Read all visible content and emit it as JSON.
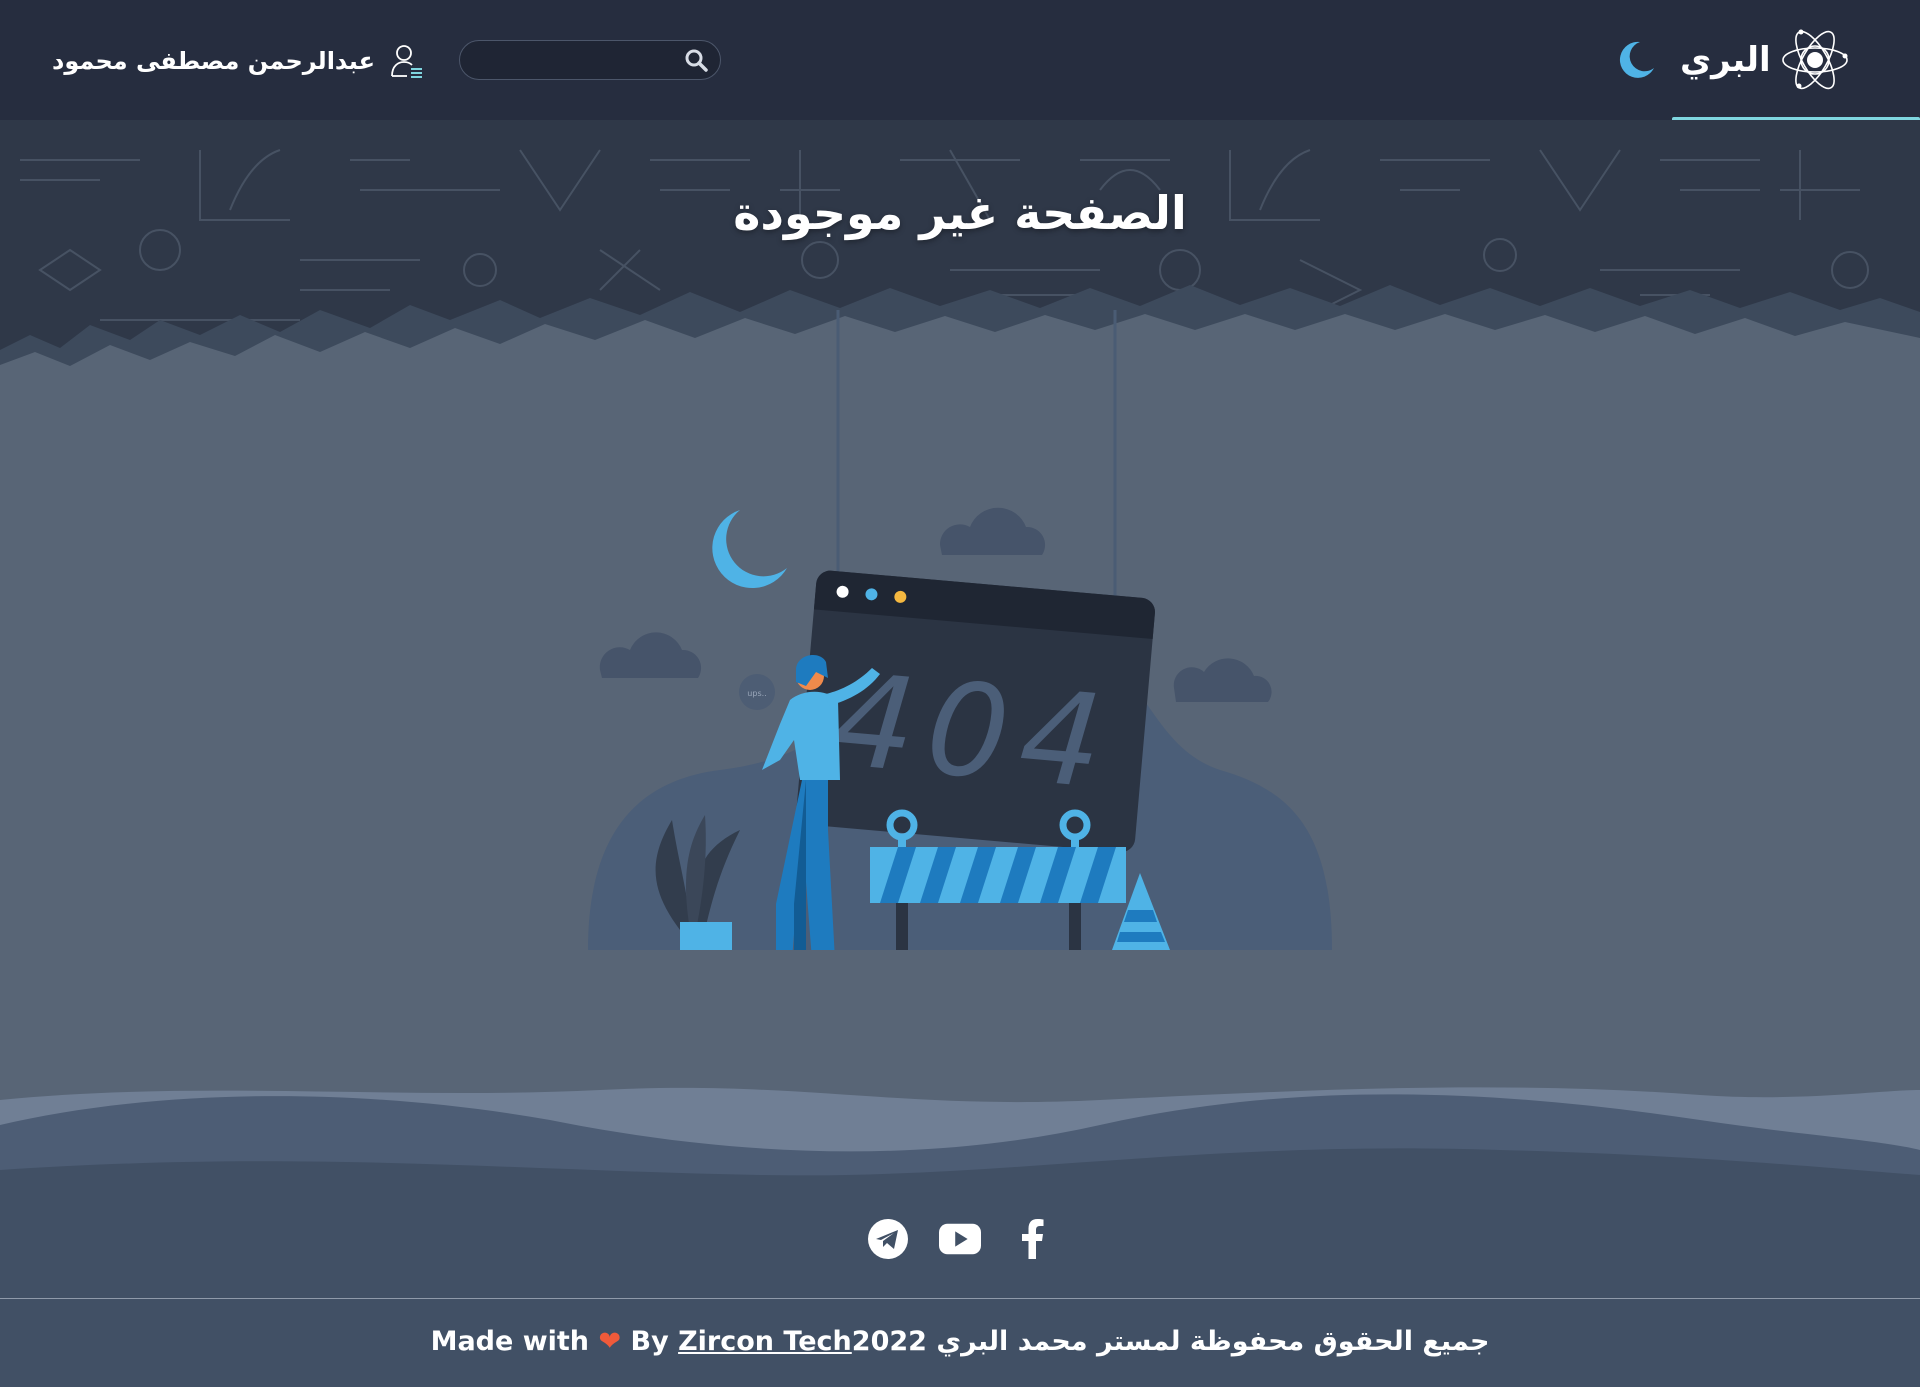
{
  "header": {
    "brand_name": "البري",
    "user_name": "عبدالرحمن مصطفى محمود",
    "search": {
      "value": "",
      "placeholder": ""
    }
  },
  "main": {
    "title": "الصفحة غير موجودة",
    "illustration": {
      "code_text": "404",
      "bubble_text": "ups.."
    }
  },
  "footer": {
    "socials": [
      "telegram-icon",
      "youtube-icon",
      "facebook-icon"
    ],
    "copyright_ar": "جميع الحقوق محفوظة لمستر محمد البري 2022",
    "made_with": "Made with",
    "by": "By",
    "company": "Zircon Tech"
  },
  "colors": {
    "header_bg": "#262d3f",
    "page_bg": "#586576",
    "footer_bg": "#415065",
    "accent_blue": "#4fb3e6",
    "active_underline": "#7fd6e0",
    "heart": "#f05a3a"
  }
}
